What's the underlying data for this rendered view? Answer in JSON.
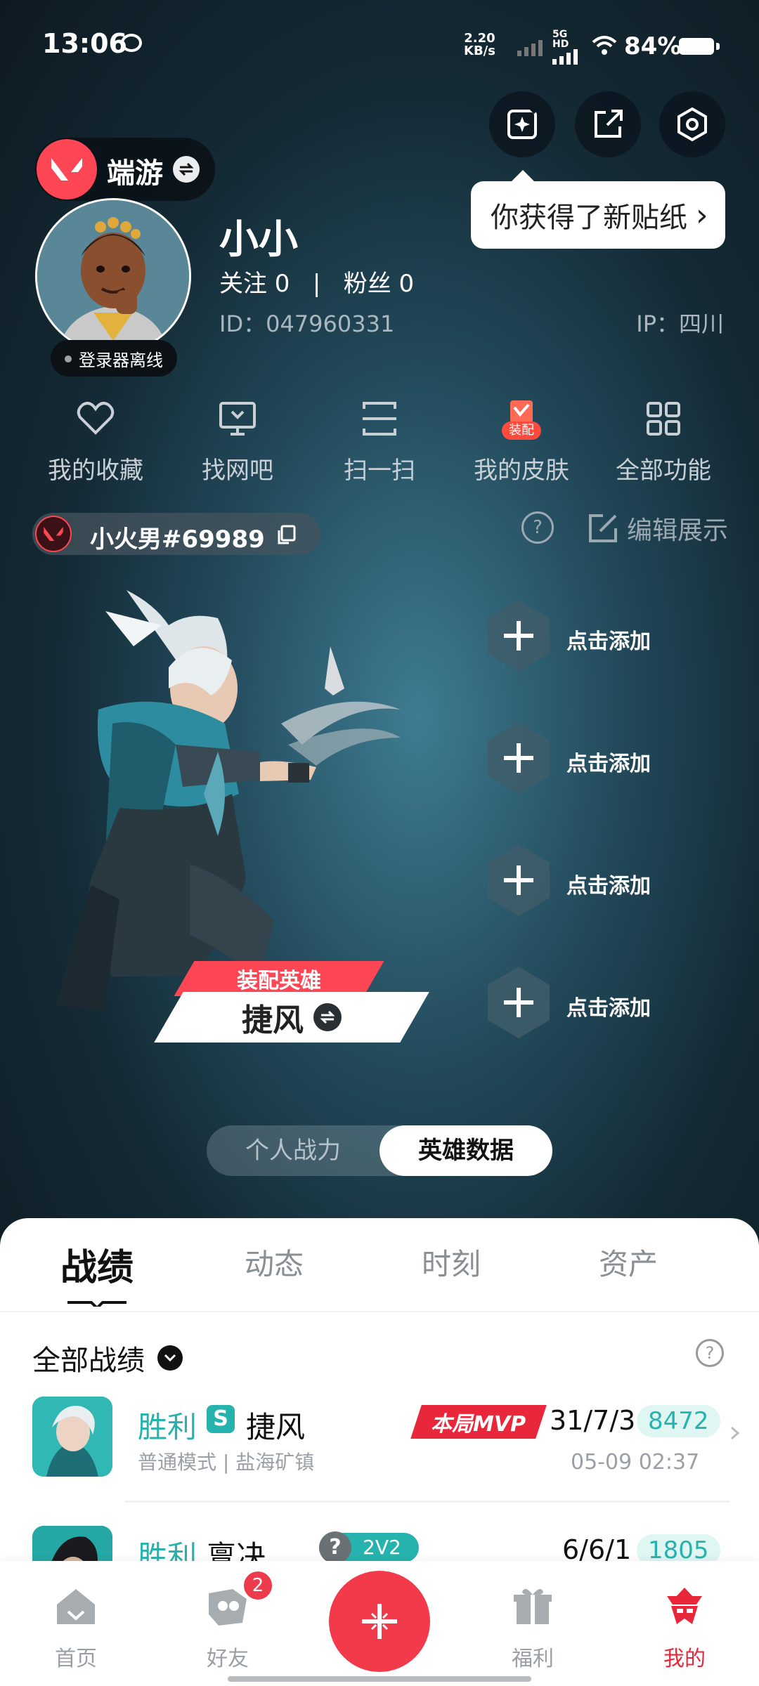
{
  "status_bar": {
    "time": "13:06",
    "net_speed": "2.20",
    "net_unit": "KB/s",
    "signal_label": "5G HD",
    "battery": "84%"
  },
  "header": {
    "tooltip": "你获得了新贴纸",
    "tooltip_chevron": "›"
  },
  "game_switch": {
    "name": "端游"
  },
  "profile": {
    "nickname": "小小",
    "follow_text": "关注 0   |   粉丝 0",
    "id_text": "ID：047960331",
    "ip_text": "IP：四川",
    "login_status": "登录器离线"
  },
  "quick_actions": [
    {
      "label": "我的收藏",
      "icon": "heart-icon"
    },
    {
      "label": "找网吧",
      "icon": "monitor-icon"
    },
    {
      "label": "扫一扫",
      "icon": "scan-icon"
    },
    {
      "label": "我的皮肤",
      "icon": "skin-icon",
      "badge": "装配"
    },
    {
      "label": "全部功能",
      "icon": "grid-icon"
    }
  ],
  "player": {
    "riot_id": "小火男#69989",
    "edit_label": "编辑展示",
    "help": "?"
  },
  "showcase": {
    "slots": [
      "点击添加",
      "点击添加",
      "点击添加",
      "点击添加"
    ],
    "badge_top": "装配英雄",
    "agent_name": "捷风"
  },
  "toggle": {
    "option1": "个人战力",
    "option2": "英雄数据",
    "selected": "英雄数据"
  },
  "tabs": [
    "战绩",
    "动态",
    "时刻",
    "资产"
  ],
  "records_section": {
    "title": "全部战绩",
    "help": "?"
  },
  "records": [
    {
      "result": "胜利",
      "mode_badge": "S",
      "agent": "捷风",
      "mvp": "本局MVP",
      "kda": "31/7/3",
      "score": "8472",
      "mode": "普通模式 | 盐海矿镇",
      "time": "05-09 02:37"
    },
    {
      "result": "胜利",
      "agent": "亶决",
      "tag": "2V2",
      "kda": "6/6/1",
      "score": "1805"
    }
  ],
  "bottom_nav": [
    {
      "label": "首页",
      "icon": "home-icon"
    },
    {
      "label": "好友",
      "icon": "friends-icon",
      "badge": "2"
    },
    {
      "label": "福利",
      "icon": "gift-icon"
    },
    {
      "label": "我的",
      "icon": "profile-icon",
      "active": true
    }
  ],
  "colors": {
    "accent": "#ff4655",
    "teal": "#27b3ad",
    "dark_bg": "#0f1c24"
  }
}
